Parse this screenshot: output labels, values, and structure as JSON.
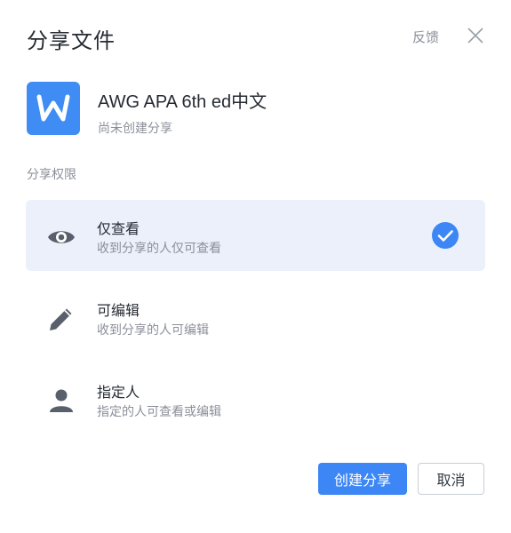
{
  "dialog": {
    "title": "分享文件",
    "feedback_label": "反馈",
    "close_icon": "close-icon"
  },
  "file": {
    "icon": "word-doc-icon",
    "icon_color": "#3f8cf5",
    "name": "AWG APA 6th ed中文",
    "status": "尚未创建分享"
  },
  "permissions": {
    "label": "分享权限",
    "options": [
      {
        "icon": "eye-icon",
        "title": "仅查看",
        "desc": "收到分享的人仅可查看",
        "selected": true
      },
      {
        "icon": "pencil-icon",
        "title": "可编辑",
        "desc": "收到分享的人可编辑",
        "selected": false
      },
      {
        "icon": "person-icon",
        "title": "指定人",
        "desc": "指定的人可查看或编辑",
        "selected": false
      }
    ]
  },
  "actions": {
    "create_label": "创建分享",
    "cancel_label": "取消",
    "primary_color": "#3d86f6"
  }
}
